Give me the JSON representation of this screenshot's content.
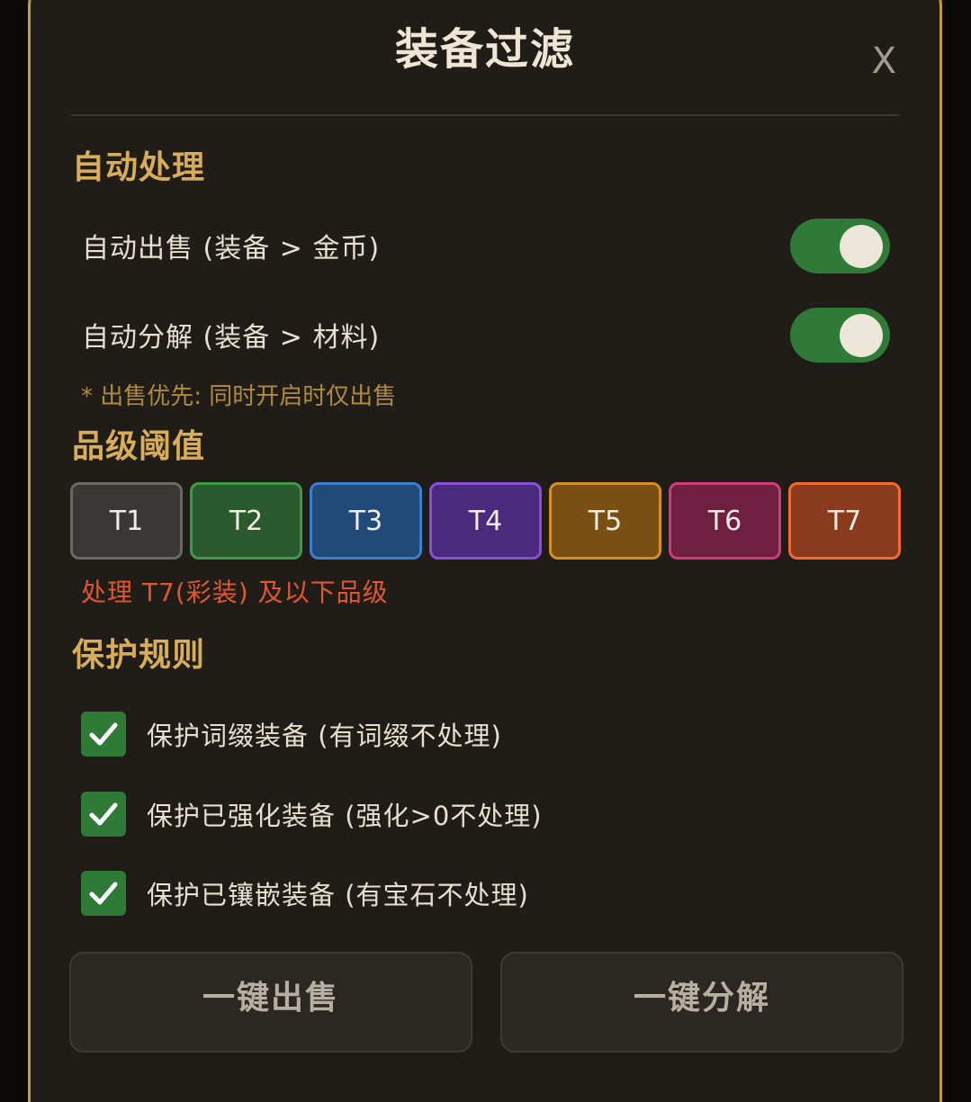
{
  "dialog": {
    "title": "装备过滤",
    "close_label": "X"
  },
  "auto_process": {
    "section_title": "自动处理",
    "toggles": [
      {
        "label": "自动出售 (装备 > 金币)",
        "on": true
      },
      {
        "label": "自动分解 (装备 > 材料)",
        "on": true
      }
    ],
    "note": "* 出售优先: 同时开启时仅出售"
  },
  "quality_threshold": {
    "section_title": "品级阈值",
    "tiers": [
      {
        "label": "T1",
        "bg": "#3a3836",
        "border": "#6b6762"
      },
      {
        "label": "T2",
        "bg": "#2a5a2e",
        "border": "#3f9a46"
      },
      {
        "label": "T3",
        "bg": "#224a78",
        "border": "#3a7fd0"
      },
      {
        "label": "T4",
        "bg": "#4b2a7e",
        "border": "#8a4fd8"
      },
      {
        "label": "T5",
        "bg": "#7a4f14",
        "border": "#d38f26"
      },
      {
        "label": "T6",
        "bg": "#6f1f40",
        "border": "#d23a7a"
      },
      {
        "label": "T7",
        "bg": "#8a3a1d",
        "border": "#f06a33"
      }
    ],
    "selected": "T7",
    "description": "处理 T7(彩装) 及以下品级"
  },
  "protection": {
    "section_title": "保护规则",
    "rules": [
      {
        "label": "保护词缀装备 (有词缀不处理)",
        "checked": true
      },
      {
        "label": "保护已强化装备 (强化>0不处理)",
        "checked": true
      },
      {
        "label": "保护已镶嵌装备 (有宝石不处理)",
        "checked": true
      }
    ]
  },
  "actions": {
    "sell_all": "一键出售",
    "salvage_all": "一键分解"
  },
  "colors": {
    "accent_gold": "#d9ad58",
    "toggle_on": "#2f7a36",
    "warning_text": "#e0572f",
    "dialog_border": "#c49a45"
  }
}
